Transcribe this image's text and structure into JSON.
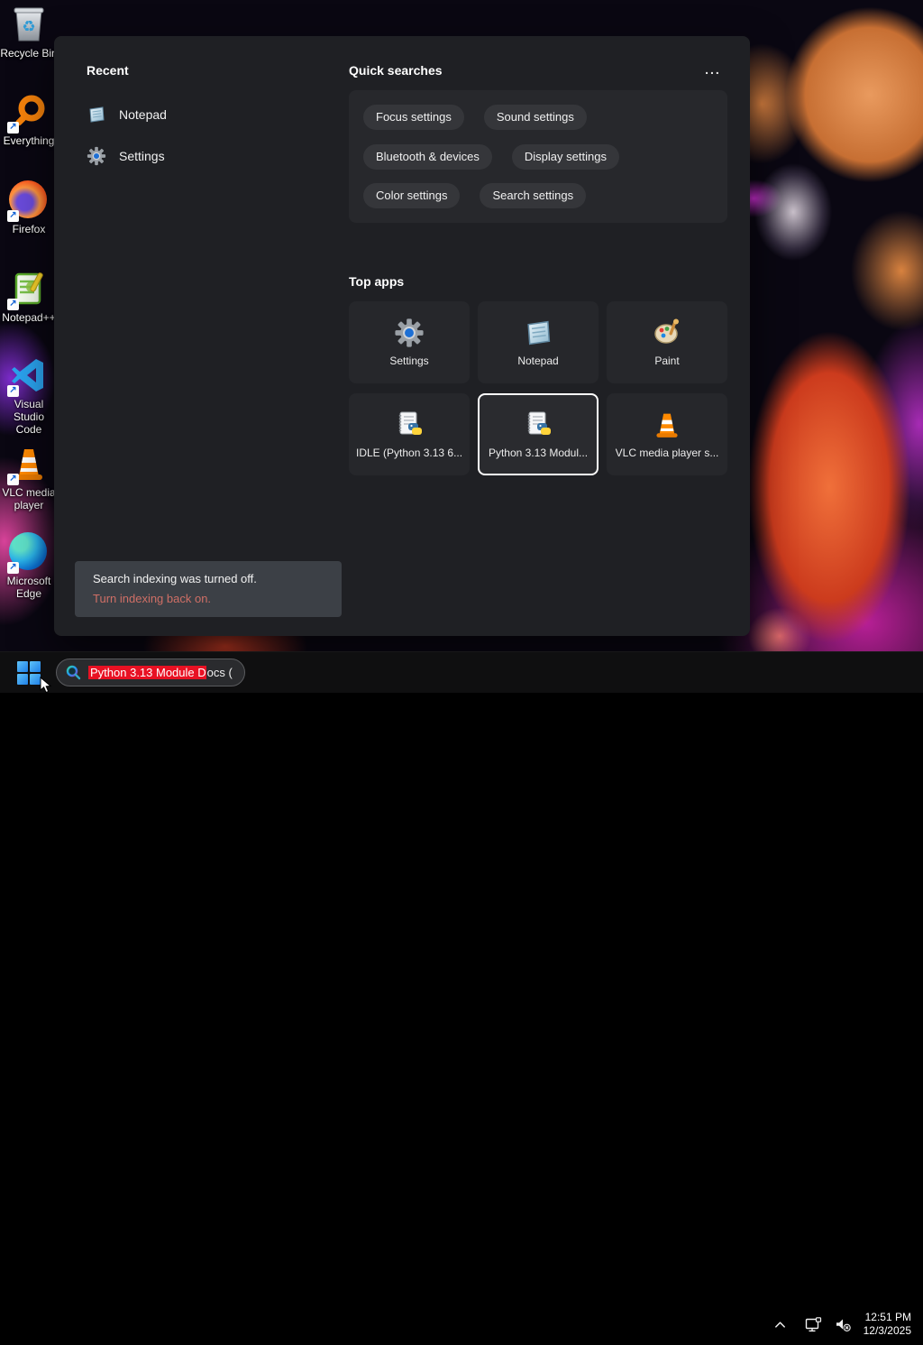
{
  "desktop": {
    "icons": [
      {
        "label": "Recycle Bin"
      },
      {
        "label": "Everything"
      },
      {
        "label": "Firefox"
      },
      {
        "label": "Notepad++"
      },
      {
        "label": "Visual Studio Code"
      },
      {
        "label": "VLC media player"
      },
      {
        "label": "Microsoft Edge"
      }
    ]
  },
  "search_panel": {
    "recent": {
      "title": "Recent",
      "items": [
        {
          "label": "Notepad"
        },
        {
          "label": "Settings"
        }
      ]
    },
    "quick_searches": {
      "title": "Quick searches",
      "more_label": "...",
      "pills": [
        "Focus settings",
        "Sound settings",
        "Bluetooth & devices",
        "Display settings",
        "Color settings",
        "Search settings"
      ]
    },
    "top_apps": {
      "title": "Top apps",
      "apps": [
        {
          "label": "Settings",
          "selected": false
        },
        {
          "label": "Notepad",
          "selected": false
        },
        {
          "label": "Paint",
          "selected": false
        },
        {
          "label": "IDLE (Python 3.13 6...",
          "selected": false
        },
        {
          "label": "Python 3.13 Modul...",
          "selected": true
        },
        {
          "label": "VLC media player s...",
          "selected": false
        }
      ]
    },
    "notice": {
      "message": "Search indexing was turned off.",
      "link": "Turn indexing back on.",
      "link_color": "#cf6f66"
    }
  },
  "taskbar": {
    "search": {
      "highlighted": "Python 3.13 Module D",
      "rest": "ocs (",
      "highlight_color": "#e81123"
    },
    "tray": {
      "time": "12:51 PM",
      "date": "12/3/2025"
    }
  }
}
